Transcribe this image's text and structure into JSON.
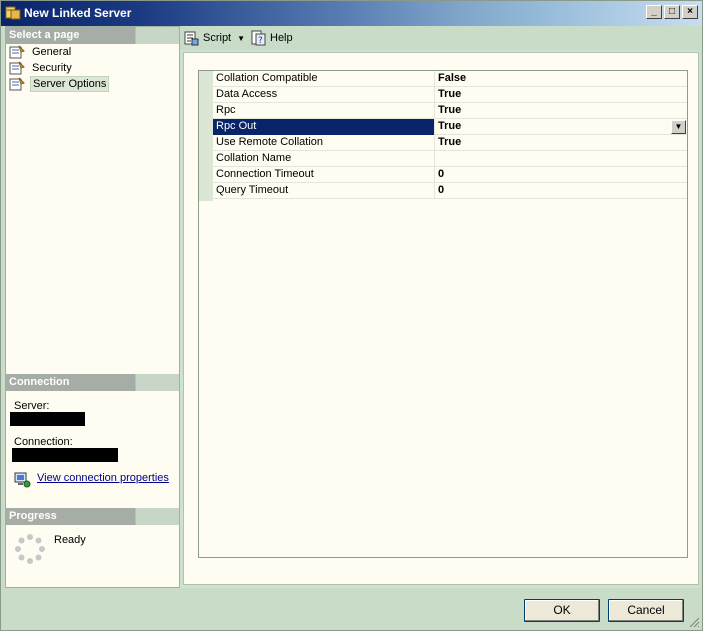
{
  "window": {
    "title": "New Linked Server",
    "controls": {
      "minimize": "_",
      "maximize": "□",
      "close": "×"
    }
  },
  "left": {
    "select_page_header": "Select a page",
    "pages": [
      {
        "label": "General",
        "icon": "page-properties-icon",
        "selected": false
      },
      {
        "label": "Security",
        "icon": "page-properties-icon",
        "selected": false
      },
      {
        "label": "Server Options",
        "icon": "page-properties-icon",
        "selected": true
      }
    ],
    "connection_header": "Connection",
    "server_label": "Server:",
    "connection_label": "Connection:",
    "view_connection_link": "View connection properties",
    "progress_header": "Progress",
    "progress_status": "Ready"
  },
  "toolbar": {
    "script_label": "Script",
    "help_label": "Help"
  },
  "properties": [
    {
      "name": "Collation Compatible",
      "value": "False",
      "selected": false
    },
    {
      "name": "Data Access",
      "value": "True",
      "selected": false
    },
    {
      "name": "Rpc",
      "value": "True",
      "selected": false
    },
    {
      "name": "Rpc Out",
      "value": "True",
      "selected": true
    },
    {
      "name": "Use Remote Collation",
      "value": "True",
      "selected": false
    },
    {
      "name": "Collation Name",
      "value": "",
      "selected": false
    },
    {
      "name": "Connection Timeout",
      "value": "0",
      "selected": false
    },
    {
      "name": "Query Timeout",
      "value": "0",
      "selected": false
    }
  ],
  "buttons": {
    "ok": "OK",
    "cancel": "Cancel"
  },
  "colors": {
    "selection": "#0a246a",
    "pane_background": "#fffdf1",
    "chrome": "#c8dcc8",
    "link": "#00008b"
  }
}
